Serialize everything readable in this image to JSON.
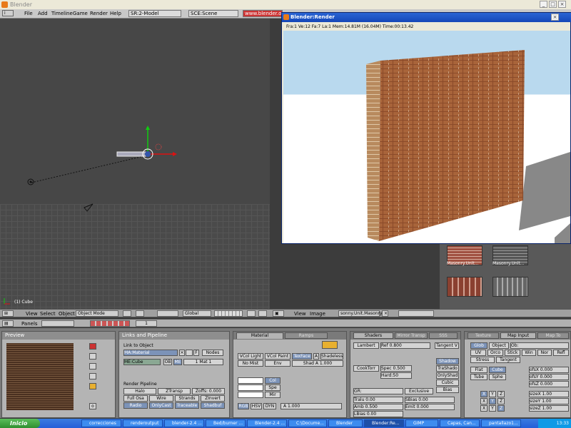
{
  "window": {
    "title": "Blender"
  },
  "menu": {
    "items": [
      "File",
      "Add",
      "Timeline",
      "Game",
      "Render",
      "Help"
    ],
    "screen_field": "SR:2-Model",
    "scene_field": "SCE:Scene",
    "url_field": "www.blender.org"
  },
  "viewport": {
    "object_label": "(1) Cube"
  },
  "render_window": {
    "title": "Blender:Render",
    "stats": "Fra:1  Ve:12 Fa:7 La:1 Mem:14.81M (16.04M) Time:00:13.42"
  },
  "thumbnails": [
    "Masonry.Unit...",
    "Masonry.Unit..."
  ],
  "view3d_header": {
    "view": "View",
    "select": "Select",
    "object": "Object",
    "mode": "Object Mode",
    "orientation": "Global"
  },
  "image_header": {
    "view": "View",
    "image": "Image",
    "image_name": "sonny.Unit.Masonry"
  },
  "buttons_header": {
    "panels": "Panels",
    "frame": "1"
  },
  "preview": {
    "title": "Preview"
  },
  "links": {
    "title": "Links and Pipeline",
    "link_to_object": "Link to Object",
    "material_name": "MA:Material",
    "f_label": "F",
    "nodes": "Nodes",
    "mesh_name": "ME:Cube",
    "ob": "OB",
    "me": "ME",
    "mat_count": "1 Mat 1",
    "render_pipeline": "Render Pipeline",
    "halo": "Halo",
    "ztransp": "ZTransp",
    "zoffs": "Zoffs: 0.000",
    "full_osa": "Full Osa",
    "wire": "Wire",
    "strands": "Strands",
    "zinvert": "ZInvert",
    "radio": "Radio",
    "onlycast": "OnlyCast",
    "traceable": "Traceable",
    "shadbuf": "Shadbuf"
  },
  "material": {
    "tab_material": "Material",
    "tab_ramps": "Ramps",
    "vcol_light": "VCol Light",
    "vcol_paint": "VCol Paint",
    "texface": "TexFace",
    "a": "A",
    "shadeless": "Shadeless",
    "no_mist": "No Mist",
    "env": "Env",
    "shad_a": "Shad A 1.000",
    "col": "Col",
    "spe": "Spe",
    "mir": "Mir",
    "rgb": "RGB",
    "hsv": "HSV",
    "dyn": "DYN",
    "alpha": "A 1.000"
  },
  "shaders": {
    "tab_shaders": "Shaders",
    "tab_mirror": "Mirror Transp",
    "tab_sss": "SSS",
    "diffuse": "Lambert",
    "ref": "Ref  0.800",
    "tangent": "Tangent V",
    "specular": "CookTorr",
    "spec": "Spec 0.500",
    "hard": "Hard:50",
    "shadow": "Shadow",
    "trashado": "TraShado",
    "onlyshad": "OnlyShad",
    "cubic": "Cubic",
    "bias": "Bias",
    "gr": "GR:",
    "exclusive": "Exclusive",
    "tralu": "Tralu 0.00",
    "sbias": "SBias 0.00",
    "amb": "Amb 0.500",
    "emit": "Emit 0.000",
    "lbias": "LBias 0.00"
  },
  "mapinput": {
    "tab_texture": "Texture",
    "tab_mapinput": "Map Input",
    "tab_mapto": "Map To",
    "glob": "Glob",
    "object": "Object",
    "ob": "Ob:",
    "uv": "UV",
    "orco": "Orco",
    "stick": "Stick",
    "win": "Win",
    "nor": "Nor",
    "refl": "Refl",
    "stress": "Stress",
    "tangent": "Tangent",
    "flat": "Flat",
    "cube": "Cube",
    "tube": "Tube",
    "sphe": "Sphe",
    "ofsx": "ofsX 0.000",
    "ofsy": "ofsY 0.000",
    "ofsz": "ofsZ 0.000",
    "sizex": "sizeX 1.00",
    "sizey": "sizeY 1.00",
    "sizez": "sizeZ 1.00",
    "x": "X",
    "y": "Y",
    "z": "Z"
  },
  "taskbar": {
    "start": "Inicio",
    "tasks": [
      "correcciones",
      "renderoutput",
      "blender-2.4 ...",
      "Bed/burner ...",
      "Blender-2.4 ...",
      "C:\\Docume...",
      "Blender",
      "Blender:Re...",
      "GIMP",
      "Capas, Can...",
      "pantallazo1..."
    ],
    "clock": "13:33"
  }
}
